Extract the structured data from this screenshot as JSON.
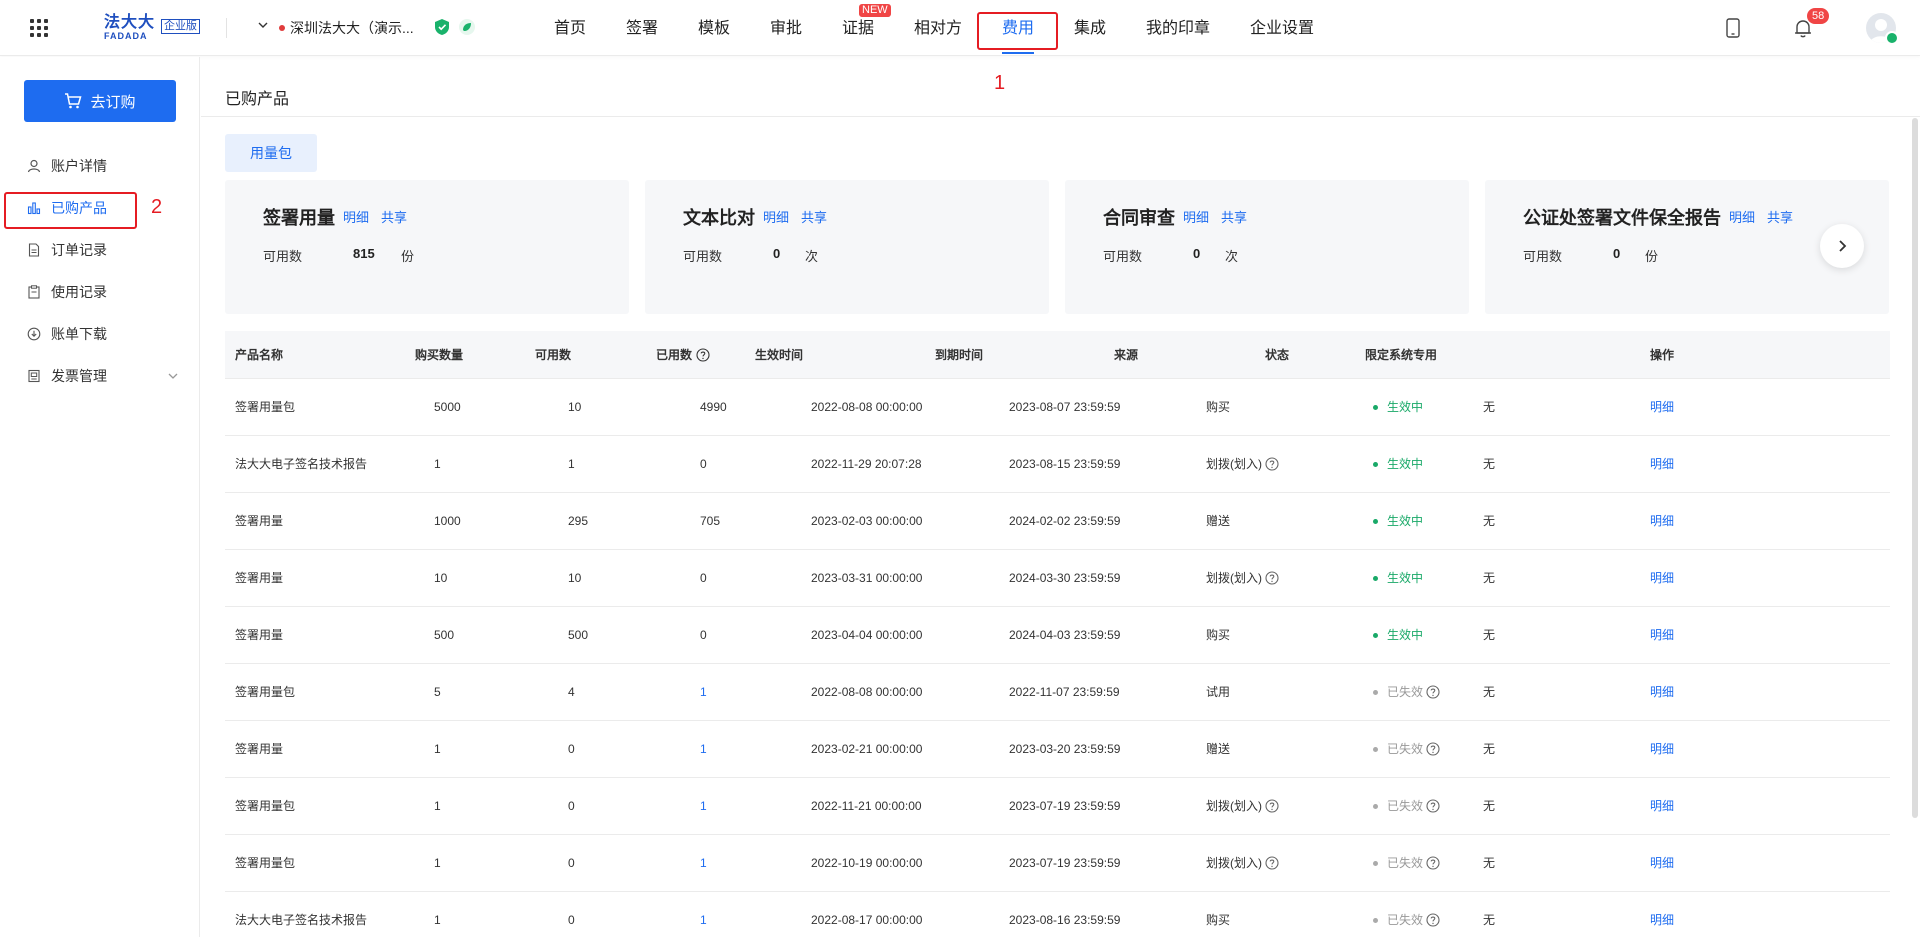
{
  "header": {
    "logo_cn": "法大大",
    "logo_en": "FADADA",
    "logo_badge": "企业版",
    "org_name": "深圳法大大（演示...",
    "nav": [
      {
        "label": "首页"
      },
      {
        "label": "签署"
      },
      {
        "label": "模板"
      },
      {
        "label": "审批"
      },
      {
        "label": "证据"
      },
      {
        "label": "相对方"
      },
      {
        "label": "费用"
      },
      {
        "label": "集成"
      },
      {
        "label": "我的印章"
      },
      {
        "label": "企业设置"
      }
    ],
    "new_badge": "NEW",
    "notification_count": "58",
    "annotation_1": "1"
  },
  "sidebar": {
    "buy_button": "去订购",
    "items": [
      {
        "label": "账户详情",
        "icon": "user-icon"
      },
      {
        "label": "已购产品",
        "icon": "bar-chart-icon"
      },
      {
        "label": "订单记录",
        "icon": "document-icon"
      },
      {
        "label": "使用记录",
        "icon": "clipboard-icon"
      },
      {
        "label": "账单下载",
        "icon": "download-icon"
      },
      {
        "label": "发票管理",
        "icon": "invoice-icon"
      }
    ],
    "annotation_2": "2"
  },
  "main": {
    "page_title": "已购产品",
    "tab": "用量包",
    "cards": [
      {
        "title": "签署用量",
        "link1": "明细",
        "link2": "共享",
        "label": "可用数",
        "value": "815",
        "unit": "份"
      },
      {
        "title": "文本比对",
        "link1": "明细",
        "link2": "共享",
        "label": "可用数",
        "value": "0",
        "unit": "次"
      },
      {
        "title": "合同审查",
        "link1": "明细",
        "link2": "共享",
        "label": "可用数",
        "value": "0",
        "unit": "次"
      },
      {
        "title": "公证处签署文件保全报告",
        "link1": "明细",
        "link2": "共享",
        "label": "可用数",
        "value": "0",
        "unit": "份"
      }
    ]
  },
  "table": {
    "headers": {
      "name": "产品名称",
      "purchased": "购买数量",
      "available": "可用数",
      "used": "已用数",
      "start": "生效时间",
      "end": "到期时间",
      "source": "来源",
      "status": "状态",
      "restricted": "限定系统专用",
      "action": "操作"
    },
    "rows": [
      {
        "name": "签署用量包",
        "purchased": "5000",
        "available": "10",
        "used": "4990",
        "start": "2022-08-08 00:00:00",
        "end": "2023-08-07 23:59:59",
        "source": "购买",
        "source_help": false,
        "status": "生效中",
        "active": true,
        "restricted": "无",
        "action": "明细"
      },
      {
        "name": "法大大电子签名技术报告",
        "purchased": "1",
        "available": "1",
        "used": "0",
        "start": "2022-11-29 20:07:28",
        "end": "2023-08-15 23:59:59",
        "source": "划拨(划入)",
        "source_help": true,
        "status": "生效中",
        "active": true,
        "restricted": "无",
        "action": "明细"
      },
      {
        "name": "签署用量",
        "purchased": "1000",
        "available": "295",
        "used": "705",
        "start": "2023-02-03 00:00:00",
        "end": "2024-02-02 23:59:59",
        "source": "赠送",
        "source_help": false,
        "status": "生效中",
        "active": true,
        "restricted": "无",
        "action": "明细"
      },
      {
        "name": "签署用量",
        "purchased": "10",
        "available": "10",
        "used": "0",
        "start": "2023-03-31 00:00:00",
        "end": "2024-03-30 23:59:59",
        "source": "划拨(划入)",
        "source_help": true,
        "status": "生效中",
        "active": true,
        "restricted": "无",
        "action": "明细"
      },
      {
        "name": "签署用量",
        "purchased": "500",
        "available": "500",
        "used": "0",
        "start": "2023-04-04 00:00:00",
        "end": "2024-04-03 23:59:59",
        "source": "购买",
        "source_help": false,
        "status": "生效中",
        "active": true,
        "restricted": "无",
        "action": "明细"
      },
      {
        "name": "签署用量包",
        "purchased": "5",
        "available": "4",
        "used": "1",
        "start": "2022-08-08 00:00:00",
        "end": "2022-11-07 23:59:59",
        "source": "试用",
        "source_help": false,
        "status": "已失效",
        "active": false,
        "restricted": "无",
        "action": "明细"
      },
      {
        "name": "签署用量",
        "purchased": "1",
        "available": "0",
        "used": "1",
        "start": "2023-02-21 00:00:00",
        "end": "2023-03-20 23:59:59",
        "source": "赠送",
        "source_help": false,
        "status": "已失效",
        "active": false,
        "restricted": "无",
        "action": "明细"
      },
      {
        "name": "签署用量包",
        "purchased": "1",
        "available": "0",
        "used": "1",
        "start": "2022-11-21 00:00:00",
        "end": "2023-07-19 23:59:59",
        "source": "划拨(划入)",
        "source_help": true,
        "status": "已失效",
        "active": false,
        "restricted": "无",
        "action": "明细"
      },
      {
        "name": "签署用量包",
        "purchased": "1",
        "available": "0",
        "used": "1",
        "start": "2022-10-19 00:00:00",
        "end": "2023-07-19 23:59:59",
        "source": "划拨(划入)",
        "source_help": true,
        "status": "已失效",
        "active": false,
        "restricted": "无",
        "action": "明细"
      },
      {
        "name": "法大大电子签名技术报告",
        "purchased": "1",
        "available": "0",
        "used": "1",
        "start": "2022-08-17 00:00:00",
        "end": "2023-08-16 23:59:59",
        "source": "购买",
        "source_help": false,
        "status": "已失效",
        "active": false,
        "restricted": "无",
        "action": "明细"
      }
    ]
  },
  "colors": {
    "primary": "#1e6cf0",
    "active_status": "#19a968",
    "inactive_status": "#999999",
    "annotation": "#e51c23"
  }
}
